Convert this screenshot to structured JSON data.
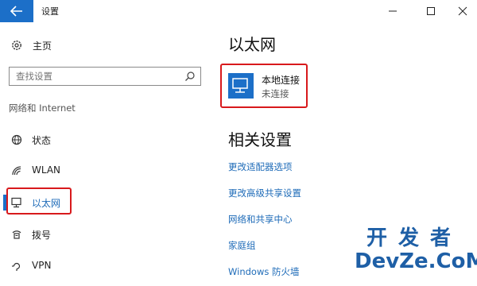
{
  "window": {
    "title": "设置",
    "icons": {
      "back": "back-arrow-icon",
      "minimize": "minimize-icon",
      "maximize": "maximize-icon",
      "close": "close-icon"
    },
    "accent_color": "#1c6fc8",
    "highlight_color": "#d8191c"
  },
  "sidebar": {
    "home": {
      "label": "主页",
      "icon": "gear-icon"
    },
    "search": {
      "placeholder": "查找设置",
      "icon": "search-icon"
    },
    "section_heading": "网络和 Internet",
    "items": [
      {
        "label": "状态",
        "icon": "globe-icon",
        "selected": false
      },
      {
        "label": "WLAN",
        "icon": "wifi-icon",
        "selected": false
      },
      {
        "label": "以太网",
        "icon": "ethernet-icon",
        "selected": true
      },
      {
        "label": "拨号",
        "icon": "dialup-icon",
        "selected": false
      },
      {
        "label": "VPN",
        "icon": "vpn-icon",
        "selected": false
      }
    ]
  },
  "main": {
    "title": "以太网",
    "connection": {
      "name": "本地连接",
      "status": "未连接",
      "icon": "network-monitor-icon"
    },
    "related_title": "相关设置",
    "related_links": [
      "更改适配器选项",
      "更改高级共享设置",
      "网络和共享中心",
      "家庭组",
      "Windows 防火墙"
    ]
  },
  "watermark": {
    "line1": "开发者",
    "line2": "DevZe.CoM"
  }
}
